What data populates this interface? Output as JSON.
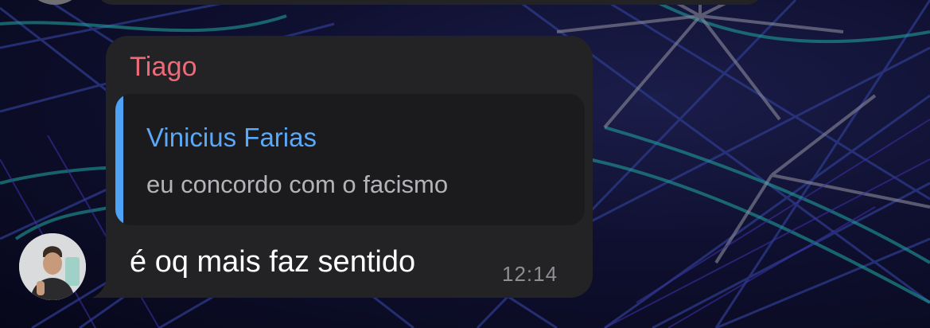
{
  "message": {
    "sender_name": "Tiago",
    "reply": {
      "author": "Vinicius Farias",
      "quoted_text": "eu concordo com o facismo"
    },
    "text": "é oq mais faz sentido",
    "time": "12:14"
  },
  "colors": {
    "sender": "#ef6a78",
    "reply_accent": "#4fa3f7",
    "bubble": "#232325",
    "timestamp": "#8e8e93"
  },
  "icons": {
    "sender_avatar": "user-photo-avatar"
  }
}
